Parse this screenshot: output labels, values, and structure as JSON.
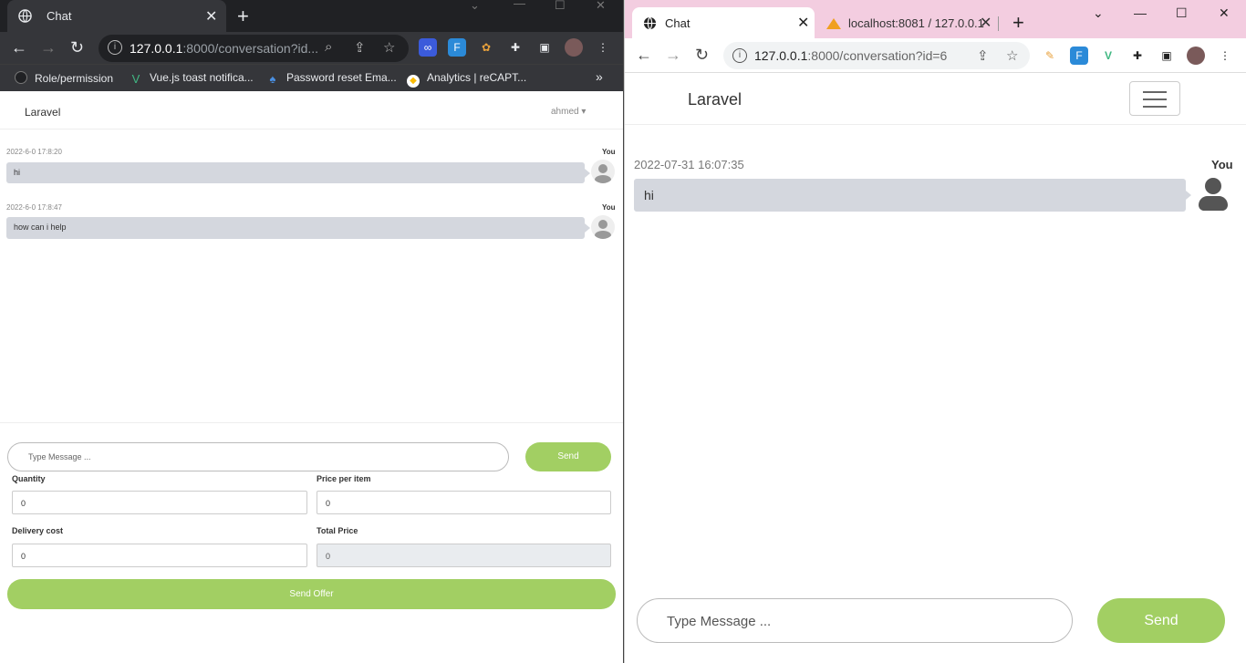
{
  "left_window": {
    "tab": {
      "title": "Chat"
    },
    "url": {
      "host": "127.0.0.1",
      "path": ":8000/conversation?id..."
    },
    "bookmarks": [
      {
        "label": "Role/permission",
        "color": "#e8eaed"
      },
      {
        "label": "Vue.js toast notifica...",
        "color": "#41b883"
      },
      {
        "label": "Password reset Ema...",
        "color": "#4a90e2"
      },
      {
        "label": "Analytics  |  reCAPT...",
        "color": "#fbbc05"
      }
    ],
    "page": {
      "brand": "Laravel",
      "user_menu": "ahmed",
      "messages": [
        {
          "time": "2022-6-0 17:8:20",
          "sender": "You",
          "text": "hi"
        },
        {
          "time": "2022-6-0 17:8:47",
          "sender": "You",
          "text": "how can i help"
        }
      ],
      "message_placeholder": "Type Message ...",
      "send_label": "Send",
      "fields": {
        "quantity_label": "Quantity",
        "quantity_value": "0",
        "price_label": "Price per item",
        "price_value": "0",
        "delivery_label": "Delivery cost",
        "delivery_value": "0",
        "total_label": "Total Price",
        "total_value": "0"
      },
      "send_offer_label": "Send Offer"
    }
  },
  "right_window": {
    "tabs": [
      {
        "title": "Chat"
      },
      {
        "title": "localhost:8081 / 127.0.0.1"
      }
    ],
    "url": {
      "host": "127.0.0.1",
      "path": ":8000/conversation?id=6"
    },
    "page": {
      "brand": "Laravel",
      "messages": [
        {
          "time": "2022-07-31 16:07:35",
          "sender": "You",
          "text": "hi"
        }
      ],
      "message_placeholder": "Type Message ...",
      "send_label": "Send"
    }
  },
  "colors": {
    "accent": "#a2cf63",
    "bubble": "#d4d7de",
    "dark_chrome": "#35363a",
    "pink_chrome": "#f3cde0"
  },
  "icons": [
    "globe-icon",
    "close-icon",
    "plus-icon",
    "back-icon",
    "forward-icon",
    "reload-icon",
    "info-icon",
    "zoom-icon",
    "share-icon",
    "star-icon",
    "extension-icon",
    "side-panel-icon",
    "profile-avatar",
    "menu-dots-icon",
    "hamburger-icon",
    "user-avatar-icon"
  ]
}
